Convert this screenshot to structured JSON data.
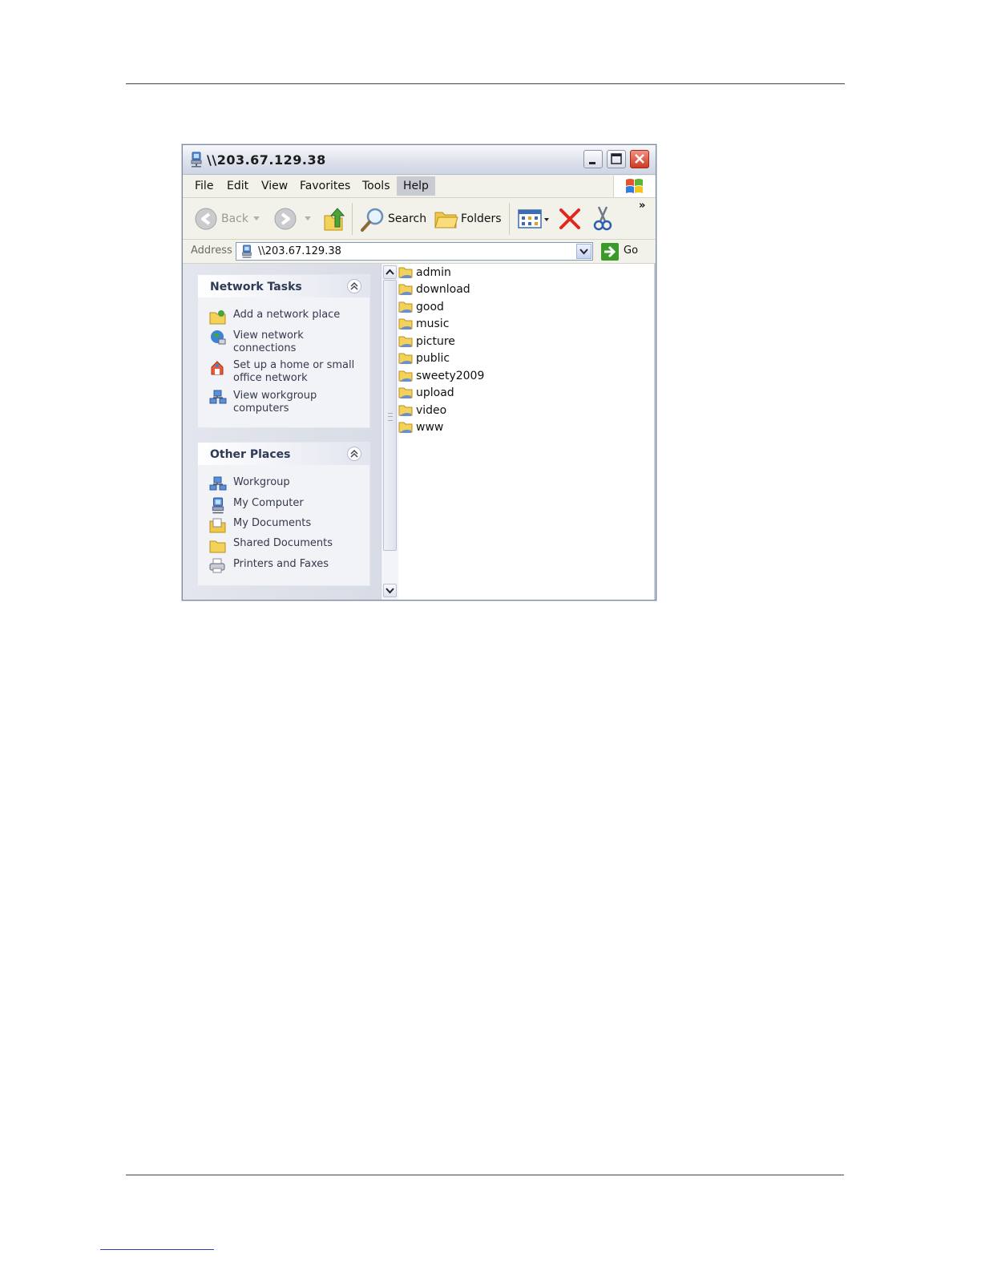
{
  "window": {
    "title": "\\\\203.67.129.38"
  },
  "menu": {
    "items": [
      "File",
      "Edit",
      "View",
      "Favorites",
      "Tools",
      "Help"
    ]
  },
  "toolbar": {
    "back_label": "Back",
    "search_label": "Search",
    "folders_label": "Folders",
    "overflow": "»"
  },
  "address": {
    "label": "Address",
    "value": "\\\\203.67.129.38",
    "go_label": "Go"
  },
  "network_tasks": {
    "title": "Network Tasks",
    "items": [
      "Add a network place",
      "View network connections",
      "Set up a home or small office network",
      "View workgroup computers"
    ]
  },
  "other_places": {
    "title": "Other Places",
    "items": [
      "Workgroup",
      "My Computer",
      "My Documents",
      "Shared Documents",
      "Printers and Faxes"
    ]
  },
  "files": [
    "admin",
    "download",
    "good",
    "music",
    "picture",
    "public",
    "sweety2009",
    "upload",
    "video",
    "www"
  ],
  "colors": {
    "title_bg": "#dde2ec",
    "close_red": "#d03a24",
    "go_green": "#3a9a2a",
    "folder_yellow": "#f3d25a"
  }
}
